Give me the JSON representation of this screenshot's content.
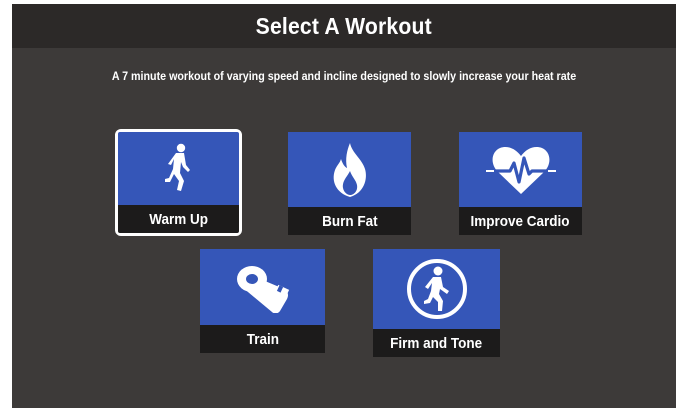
{
  "header": {
    "title": "Select A Workout"
  },
  "description": "A 7 minute workout of varying speed and incline designed to slowly increase your heat rate",
  "workouts": [
    {
      "label": "Warm Up",
      "icon": "running-figure-icon",
      "selected": true
    },
    {
      "label": "Burn Fat",
      "icon": "flame-icon",
      "selected": false
    },
    {
      "label": "Improve Cardio",
      "icon": "heartbeat-icon",
      "selected": false
    },
    {
      "label": "Train",
      "icon": "whistle-icon",
      "selected": false
    },
    {
      "label": "Firm and Tone",
      "icon": "woman-running-icon",
      "selected": false
    }
  ],
  "colors": {
    "background": "#3d3a39",
    "header": "#2c2928",
    "tile_art": "#3556b8",
    "tile_label": "#1c1b1b",
    "text": "#ffffff"
  }
}
